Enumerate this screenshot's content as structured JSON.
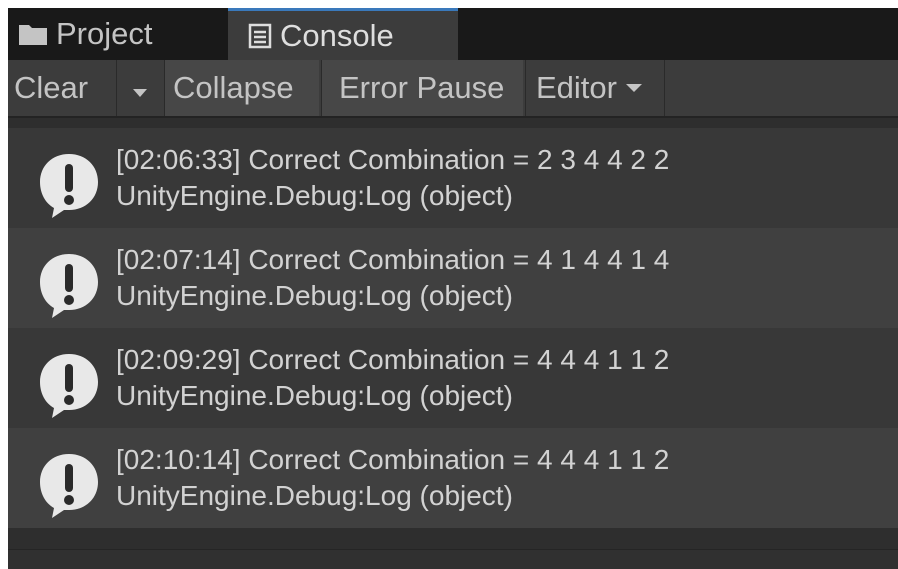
{
  "tabs": [
    {
      "label": "Project",
      "icon": "folder-icon"
    },
    {
      "label": "Console",
      "icon": "console-icon"
    }
  ],
  "toolbar": {
    "clear_label": "Clear",
    "collapse_label": "Collapse",
    "error_pause_label": "Error Pause",
    "editor_label": "Editor"
  },
  "logs": [
    {
      "message": "[02:06:33] Correct Combination = 2 3 4 4 2 2",
      "source": "UnityEngine.Debug:Log (object)"
    },
    {
      "message": "[02:07:14] Correct Combination = 4 1 4 4 1 4",
      "source": "UnityEngine.Debug:Log (object)"
    },
    {
      "message": "[02:09:29] Correct Combination = 4 4 4 1 1 2",
      "source": "UnityEngine.Debug:Log (object)"
    },
    {
      "message": "[02:10:14] Correct Combination = 4 4 4 1 1 2",
      "source": "UnityEngine.Debug:Log (object)"
    }
  ],
  "colors": {
    "panel_bg": "#282828",
    "tab_active_accent": "#3a79bb",
    "text": "#d2d2d2"
  }
}
